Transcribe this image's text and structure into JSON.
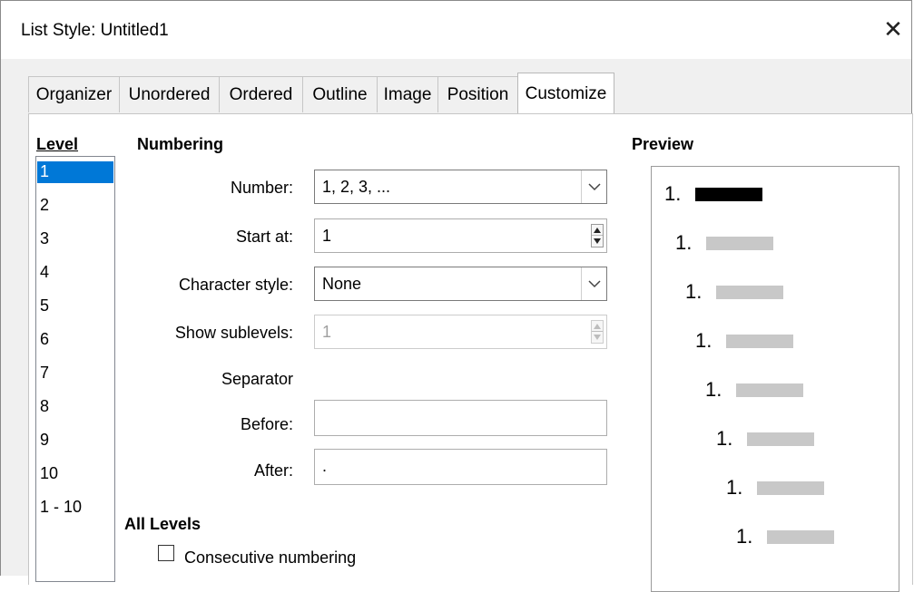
{
  "window": {
    "title": "List Style: Untitled1",
    "close_glyph": "✕"
  },
  "tabs": [
    {
      "label": "Organizer"
    },
    {
      "label": "Unordered"
    },
    {
      "label": "Ordered"
    },
    {
      "label": "Outline"
    },
    {
      "label": "Image"
    },
    {
      "label": "Position"
    },
    {
      "label": "Customize"
    }
  ],
  "active_tab": "Customize",
  "level": {
    "heading": "Level",
    "items": [
      "1",
      "2",
      "3",
      "4",
      "5",
      "6",
      "7",
      "8",
      "9",
      "10",
      "1 - 10"
    ],
    "selected": "1"
  },
  "numbering": {
    "heading": "Numbering",
    "number_label": "Number:",
    "number_value": "1, 2, 3, ...",
    "start_label": "Start at:",
    "start_value": "1",
    "charstyle_label": "Character style:",
    "charstyle_value": "None",
    "sublevels_label": "Show sublevels:",
    "sublevels_value": "1",
    "separator_label": "Separator",
    "before_label": "Before:",
    "before_value": "",
    "after_label": "After:",
    "after_value": "."
  },
  "all_levels": {
    "heading": "All Levels",
    "consecutive_label": "Consecutive numbering",
    "consecutive_checked": false
  },
  "preview": {
    "heading": "Preview",
    "rows": [
      "1.",
      "1.",
      "1.",
      "1.",
      "1.",
      "1.",
      "1.",
      "1."
    ]
  },
  "colors": {
    "selection": "#0078d7",
    "preview_active_bar": "#000000",
    "preview_bar": "#c8c8c8"
  }
}
